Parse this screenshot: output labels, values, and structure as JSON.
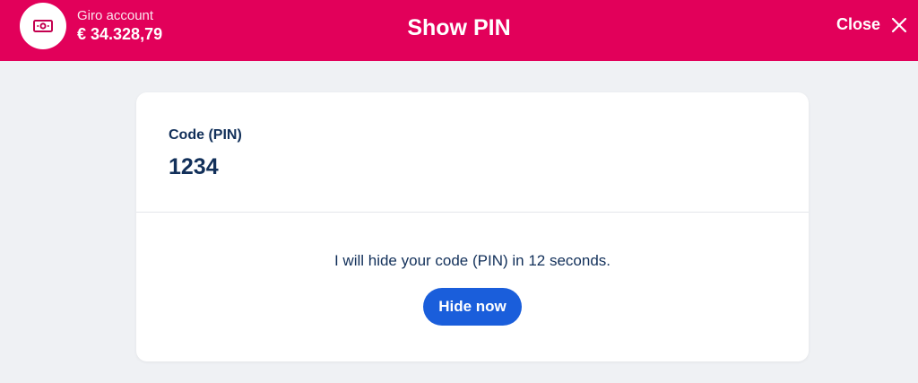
{
  "header": {
    "account_name": "Giro account",
    "account_balance": "€ 34.328,79",
    "account_icon": "banknote-icon",
    "title": "Show PIN",
    "close_label": "Close",
    "close_icon": "close-icon",
    "background_color": "#e2005a"
  },
  "pin_card": {
    "label": "Code (PIN)",
    "value": "1234",
    "hide_message": "I will hide your code (PIN) in 12 seconds.",
    "hide_button_label": "Hide now",
    "button_color": "#1a5edb"
  }
}
